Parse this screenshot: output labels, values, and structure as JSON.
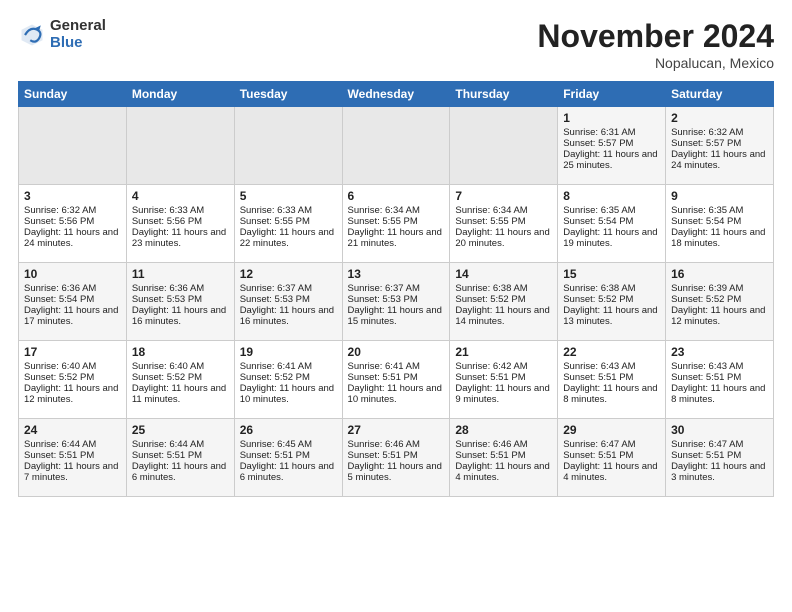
{
  "header": {
    "logo_general": "General",
    "logo_blue": "Blue",
    "month_title": "November 2024",
    "location": "Nopalucan, Mexico"
  },
  "weekdays": [
    "Sunday",
    "Monday",
    "Tuesday",
    "Wednesday",
    "Thursday",
    "Friday",
    "Saturday"
  ],
  "weeks": [
    [
      {
        "day": "",
        "info": ""
      },
      {
        "day": "",
        "info": ""
      },
      {
        "day": "",
        "info": ""
      },
      {
        "day": "",
        "info": ""
      },
      {
        "day": "",
        "info": ""
      },
      {
        "day": "1",
        "info": "Sunrise: 6:31 AM\nSunset: 5:57 PM\nDaylight: 11 hours and 25 minutes."
      },
      {
        "day": "2",
        "info": "Sunrise: 6:32 AM\nSunset: 5:57 PM\nDaylight: 11 hours and 24 minutes."
      }
    ],
    [
      {
        "day": "3",
        "info": "Sunrise: 6:32 AM\nSunset: 5:56 PM\nDaylight: 11 hours and 24 minutes."
      },
      {
        "day": "4",
        "info": "Sunrise: 6:33 AM\nSunset: 5:56 PM\nDaylight: 11 hours and 23 minutes."
      },
      {
        "day": "5",
        "info": "Sunrise: 6:33 AM\nSunset: 5:55 PM\nDaylight: 11 hours and 22 minutes."
      },
      {
        "day": "6",
        "info": "Sunrise: 6:34 AM\nSunset: 5:55 PM\nDaylight: 11 hours and 21 minutes."
      },
      {
        "day": "7",
        "info": "Sunrise: 6:34 AM\nSunset: 5:55 PM\nDaylight: 11 hours and 20 minutes."
      },
      {
        "day": "8",
        "info": "Sunrise: 6:35 AM\nSunset: 5:54 PM\nDaylight: 11 hours and 19 minutes."
      },
      {
        "day": "9",
        "info": "Sunrise: 6:35 AM\nSunset: 5:54 PM\nDaylight: 11 hours and 18 minutes."
      }
    ],
    [
      {
        "day": "10",
        "info": "Sunrise: 6:36 AM\nSunset: 5:54 PM\nDaylight: 11 hours and 17 minutes."
      },
      {
        "day": "11",
        "info": "Sunrise: 6:36 AM\nSunset: 5:53 PM\nDaylight: 11 hours and 16 minutes."
      },
      {
        "day": "12",
        "info": "Sunrise: 6:37 AM\nSunset: 5:53 PM\nDaylight: 11 hours and 16 minutes."
      },
      {
        "day": "13",
        "info": "Sunrise: 6:37 AM\nSunset: 5:53 PM\nDaylight: 11 hours and 15 minutes."
      },
      {
        "day": "14",
        "info": "Sunrise: 6:38 AM\nSunset: 5:52 PM\nDaylight: 11 hours and 14 minutes."
      },
      {
        "day": "15",
        "info": "Sunrise: 6:38 AM\nSunset: 5:52 PM\nDaylight: 11 hours and 13 minutes."
      },
      {
        "day": "16",
        "info": "Sunrise: 6:39 AM\nSunset: 5:52 PM\nDaylight: 11 hours and 12 minutes."
      }
    ],
    [
      {
        "day": "17",
        "info": "Sunrise: 6:40 AM\nSunset: 5:52 PM\nDaylight: 11 hours and 12 minutes."
      },
      {
        "day": "18",
        "info": "Sunrise: 6:40 AM\nSunset: 5:52 PM\nDaylight: 11 hours and 11 minutes."
      },
      {
        "day": "19",
        "info": "Sunrise: 6:41 AM\nSunset: 5:52 PM\nDaylight: 11 hours and 10 minutes."
      },
      {
        "day": "20",
        "info": "Sunrise: 6:41 AM\nSunset: 5:51 PM\nDaylight: 11 hours and 10 minutes."
      },
      {
        "day": "21",
        "info": "Sunrise: 6:42 AM\nSunset: 5:51 PM\nDaylight: 11 hours and 9 minutes."
      },
      {
        "day": "22",
        "info": "Sunrise: 6:43 AM\nSunset: 5:51 PM\nDaylight: 11 hours and 8 minutes."
      },
      {
        "day": "23",
        "info": "Sunrise: 6:43 AM\nSunset: 5:51 PM\nDaylight: 11 hours and 8 minutes."
      }
    ],
    [
      {
        "day": "24",
        "info": "Sunrise: 6:44 AM\nSunset: 5:51 PM\nDaylight: 11 hours and 7 minutes."
      },
      {
        "day": "25",
        "info": "Sunrise: 6:44 AM\nSunset: 5:51 PM\nDaylight: 11 hours and 6 minutes."
      },
      {
        "day": "26",
        "info": "Sunrise: 6:45 AM\nSunset: 5:51 PM\nDaylight: 11 hours and 6 minutes."
      },
      {
        "day": "27",
        "info": "Sunrise: 6:46 AM\nSunset: 5:51 PM\nDaylight: 11 hours and 5 minutes."
      },
      {
        "day": "28",
        "info": "Sunrise: 6:46 AM\nSunset: 5:51 PM\nDaylight: 11 hours and 4 minutes."
      },
      {
        "day": "29",
        "info": "Sunrise: 6:47 AM\nSunset: 5:51 PM\nDaylight: 11 hours and 4 minutes."
      },
      {
        "day": "30",
        "info": "Sunrise: 6:47 AM\nSunset: 5:51 PM\nDaylight: 11 hours and 3 minutes."
      }
    ]
  ]
}
